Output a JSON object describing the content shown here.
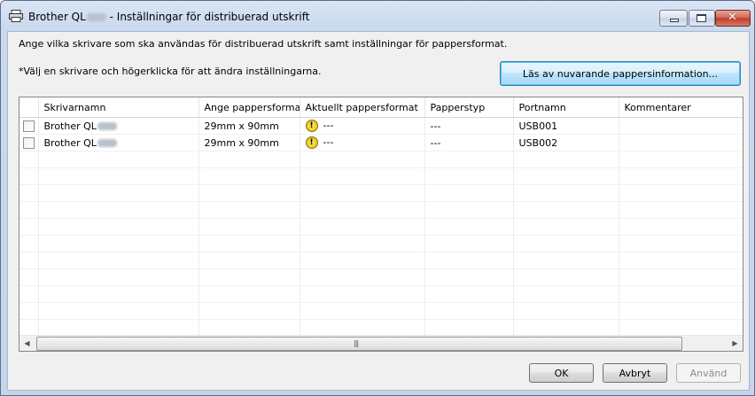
{
  "window": {
    "title_prefix": "Brother QL",
    "title_suffix": " - Inställningar för distribuerad utskrift"
  },
  "instructions": {
    "line1": "Ange vilka skrivare som ska användas för distribuerad utskrift samt inställningar för pappersformat.",
    "line2": "*Välj en skrivare och högerklicka för att ändra inställningarna."
  },
  "read_paper_button": "Läs av nuvarande pappersinformation...",
  "table": {
    "columns": [
      "Skrivarnamn",
      "Ange pappersformat",
      "Aktuellt pappersformat",
      "Papperstyp",
      "Portnamn",
      "Kommentarer"
    ],
    "rows": [
      {
        "name": "Brother QL",
        "paper_format": "29mm x 90mm",
        "current_format": "---",
        "paper_type": "---",
        "port": "USB001",
        "comment": ""
      },
      {
        "name": "Brother QL",
        "paper_format": "29mm x 90mm",
        "current_format": "---",
        "paper_type": "---",
        "port": "USB002",
        "comment": ""
      }
    ]
  },
  "buttons": {
    "ok": "OK",
    "cancel": "Avbryt",
    "apply": "Använd"
  }
}
